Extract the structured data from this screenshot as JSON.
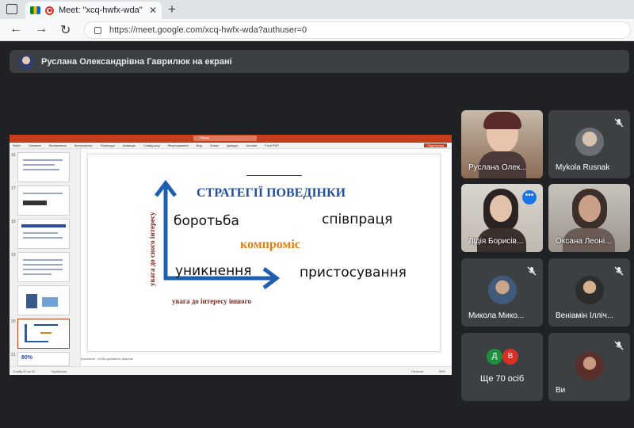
{
  "browser": {
    "tab_title": "Meet: \"xcq-hwfx-wda\"",
    "tab_close": "✕",
    "new_tab": "+",
    "url": "https://meet.google.com/xcq-hwfx-wda?authuser=0"
  },
  "banner": {
    "text": "Руслана Олександрівна Гаврилюк на екрані"
  },
  "presentation": {
    "window_title": "НовиЙ Об_20 Академічна добречесність. Закрилизм вимоги ректорів та 1-й ф... — PowerPoint",
    "search_placeholder": "Пошук",
    "menu": [
      "Файл",
      "Основне",
      "Вставлення",
      "Конструктор",
      "Переходи",
      "Анімація",
      "Слайд-шоу",
      "Рецензування",
      "Вид",
      "Запис",
      "Довідка",
      "Acrobat",
      "Foxit PDF"
    ],
    "share_label": "Поділитися",
    "thumb_numbers": [
      "16",
      "17",
      "18",
      "19",
      "20",
      "21"
    ],
    "thumb_21_text": "80%",
    "slide": {
      "title": "СТРАТЕГІЇ ПОВЕДІНКИ",
      "top_left": "боротьба",
      "top_right": "співпраця",
      "center": "компроміс",
      "bottom_left": "уникнення",
      "bottom_right": "пристосування",
      "axis_y": "увага до свого інтересу",
      "axis_x": "увага до інтересу іншого"
    },
    "notes_hint": "Щелкните, чтобы добавить заметки",
    "status_left": "Слайд 20 из 22",
    "status_lang": "Українська",
    "status_notes": "Нотатки",
    "zoom": "59%"
  },
  "participants": [
    {
      "name": "Руслана Олек...",
      "type": "video",
      "muted": false
    },
    {
      "name": "Mykola Rusnak",
      "type": "avatar",
      "muted": true
    },
    {
      "name": "Лідія Борисів...",
      "type": "video",
      "muted": false,
      "active": true
    },
    {
      "name": "Оксана Леоні...",
      "type": "video",
      "muted": false
    },
    {
      "name": "Микола Мико...",
      "type": "avatar",
      "muted": true
    },
    {
      "name": "Веніамін Ілліч...",
      "type": "avatar",
      "muted": true
    },
    {
      "name": "Ще 70 осіб",
      "type": "group",
      "initials": [
        "Д",
        "В"
      ]
    },
    {
      "name": "Ви",
      "type": "avatar",
      "muted": true
    }
  ],
  "colors": {
    "accent": "#1a73e8",
    "slide_title": "#1f4e9c",
    "slide_arrow": "#1f5fb0",
    "center_word": "#e07f15",
    "axis_label": "#7b2a22",
    "ppt_red": "#c43e1c"
  }
}
